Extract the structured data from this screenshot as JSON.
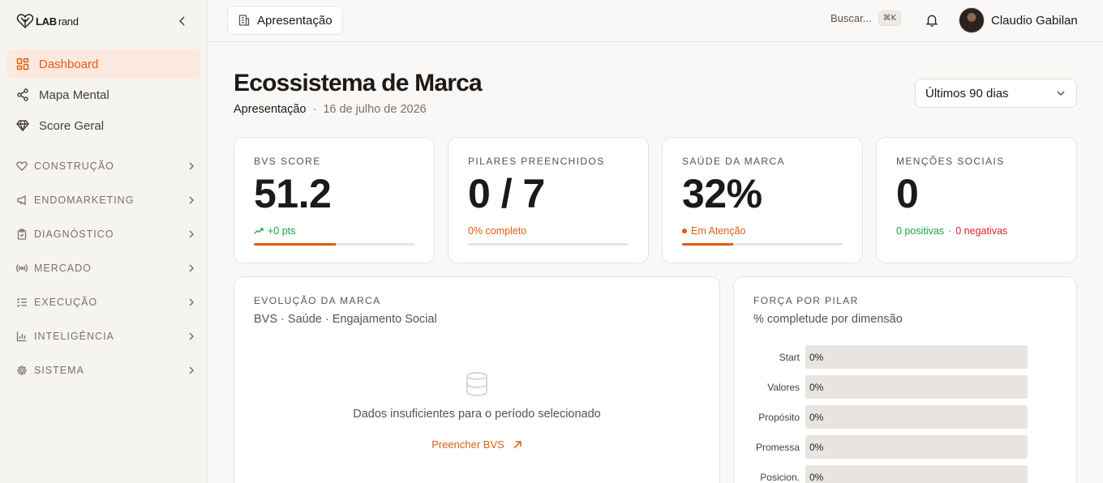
{
  "brand": {
    "logo_bold": "LAB",
    "logo_thin": "rand"
  },
  "sidebar": {
    "items": [
      {
        "label": "Dashboard",
        "icon": "dashboard-grid-icon",
        "active": true
      },
      {
        "label": "Mapa Mental",
        "icon": "share-nodes-icon"
      },
      {
        "label": "Score Geral",
        "icon": "diamond-icon"
      }
    ],
    "sections": [
      {
        "label": "CONSTRUÇÃO",
        "icon": "heart-icon"
      },
      {
        "label": "ENDOMARKETING",
        "icon": "megaphone-icon"
      },
      {
        "label": "DIAGNÓSTICO",
        "icon": "clipboard-icon"
      },
      {
        "label": "MERCADO",
        "icon": "broadcast-icon"
      },
      {
        "label": "EXECUÇÃO",
        "icon": "checklist-icon"
      },
      {
        "label": "INTELIGÊNCIA",
        "icon": "bar-chart-icon"
      },
      {
        "label": "SISTEMA",
        "icon": "gear-icon"
      }
    ]
  },
  "topbar": {
    "breadcrumb": "Apresentação",
    "search_label": "Buscar...",
    "search_shortcut": "⌘K",
    "user_name": "Claudio Gabilan"
  },
  "page": {
    "title": "Ecossistema de Marca",
    "context": "Apresentação",
    "separator": "·",
    "date": "16 de julho de 2026",
    "period": "Últimos 90 dias"
  },
  "kpis": {
    "bvs": {
      "label": "BVS SCORE",
      "value": "51.2",
      "note": "+0 pts",
      "progress": 0.51
    },
    "pillars": {
      "label": "PILARES PREENCHIDOS",
      "value": "0 / 7",
      "note": "0% completo",
      "progress": 0
    },
    "health": {
      "label": "SAÚDE DA MARCA",
      "value": "32%",
      "note": "Em Atenção",
      "progress": 0.32
    },
    "social": {
      "label": "MENÇÕES SOCIAIS",
      "value": "0",
      "positive": "0 positivas",
      "sep": "·",
      "negative": "0 negativas"
    }
  },
  "evolution": {
    "title": "EVOLUÇÃO DA MARCA",
    "subtitle": "BVS · Saúde · Engajamento Social",
    "empty_message": "Dados insuficientes para o período selecionado",
    "cta": "Preencher BVS"
  },
  "force": {
    "title": "FORÇA POR PILAR",
    "subtitle": "% completude por dimensão",
    "rows": [
      {
        "name": "Start",
        "value": "0%"
      },
      {
        "name": "Valores",
        "value": "0%"
      },
      {
        "name": "Propósito",
        "value": "0%"
      },
      {
        "name": "Promessa",
        "value": "0%"
      },
      {
        "name": "Posicion.",
        "value": "0%"
      }
    ]
  },
  "colors": {
    "accent": "#e05d12",
    "positive": "#16a34a",
    "negative": "#dc2626"
  }
}
